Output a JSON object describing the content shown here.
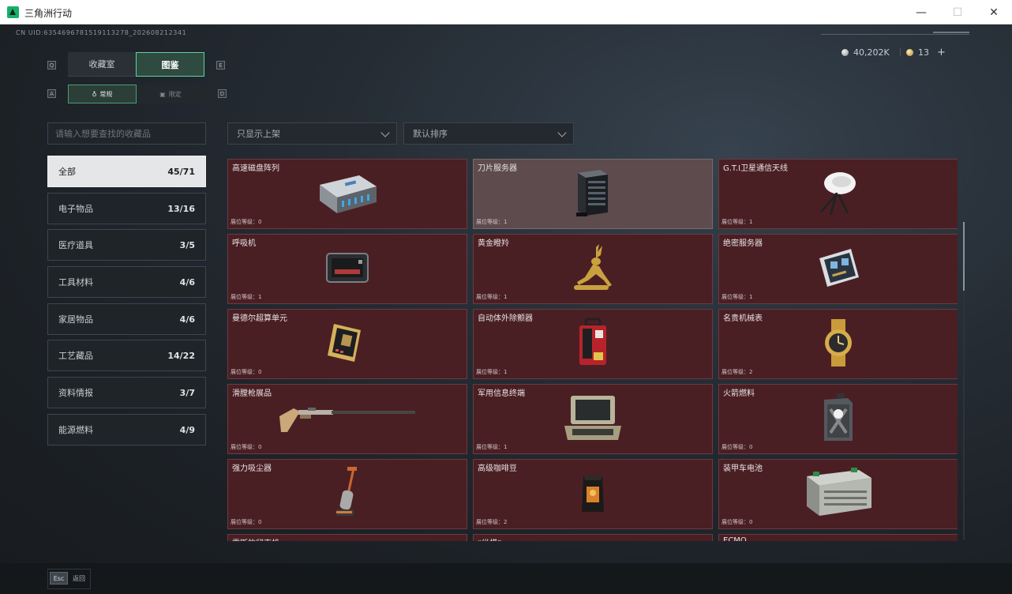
{
  "window": {
    "title": "三角洲行动"
  },
  "header": {
    "uid": "CN UID:6354696781519113278_202608212341",
    "currency": [
      {
        "icon": "silver-coin-icon",
        "value": "40,202K"
      },
      {
        "icon": "gold-coin-icon",
        "value": "13"
      }
    ],
    "add_symbol": "+"
  },
  "tabs": {
    "prev_key": "Q",
    "next_key": "E",
    "items": [
      {
        "label": "收藏室",
        "active": false
      },
      {
        "label": "图鉴",
        "active": true
      }
    ]
  },
  "sub_tabs": {
    "prev_key": "A",
    "next_key": "D",
    "items": [
      {
        "label": "常规",
        "active": true
      },
      {
        "label": "限定",
        "active": false
      }
    ]
  },
  "search": {
    "placeholder": "请输入想要查找的收藏品"
  },
  "filters": {
    "display": "只显示上架",
    "sort": "默认排序"
  },
  "categories": [
    {
      "label": "全部",
      "count": "45/71",
      "active": true
    },
    {
      "label": "电子物品",
      "count": "13/16"
    },
    {
      "label": "医疗道具",
      "count": "3/5"
    },
    {
      "label": "工具材料",
      "count": "4/6"
    },
    {
      "label": "家居物品",
      "count": "4/6"
    },
    {
      "label": "工艺藏品",
      "count": "14/22"
    },
    {
      "label": "资料情报",
      "count": "3/7"
    },
    {
      "label": "能源燃料",
      "count": "4/9"
    }
  ],
  "level_label": "展位等级：",
  "items": [
    {
      "name": "高速磁盘阵列",
      "level": "0",
      "icon": "disk-array-icon"
    },
    {
      "name": "刀片服务器",
      "level": "1",
      "icon": "blade-server-icon",
      "selected": true
    },
    {
      "name": "G.T.I卫星通信天线",
      "level": "1",
      "icon": "satellite-antenna-icon"
    },
    {
      "name": "呼吸机",
      "level": "1",
      "icon": "ventilator-icon"
    },
    {
      "name": "黄金瞪羚",
      "level": "1",
      "icon": "golden-gazelle-icon"
    },
    {
      "name": "绝密服务器",
      "level": "1",
      "icon": "secret-server-icon"
    },
    {
      "name": "曼德尔超算单元",
      "level": "0",
      "icon": "supercomputer-unit-icon"
    },
    {
      "name": "自动体外除颤器",
      "level": "1",
      "icon": "defibrillator-icon"
    },
    {
      "name": "名贵机械表",
      "level": "2",
      "icon": "mechanical-watch-icon"
    },
    {
      "name": "滑膛枪展品",
      "level": "0",
      "icon": "musket-icon"
    },
    {
      "name": "军用信息终端",
      "level": "1",
      "icon": "military-terminal-icon"
    },
    {
      "name": "火箭燃料",
      "level": "0",
      "icon": "rocket-fuel-icon"
    },
    {
      "name": "强力吸尘器",
      "level": "0",
      "icon": "vacuum-cleaner-icon"
    },
    {
      "name": "高级咖啡豆",
      "level": "2",
      "icon": "coffee-beans-icon"
    },
    {
      "name": "装甲车电池",
      "level": "0",
      "icon": "vehicle-battery-icon"
    },
    {
      "name": "雷斯的留声机",
      "level": "",
      "icon": "phonograph-icon"
    },
    {
      "name": "“纵横”",
      "level": "",
      "icon": "collectible-icon"
    },
    {
      "name": "ECMO",
      "level": "",
      "icon": "ecmo-icon"
    }
  ],
  "footer": {
    "esc_key": "Esc",
    "back_label": "返回"
  },
  "colors": {
    "accent": "#5fd39a",
    "card_bg": "#4a1f24",
    "card_selected": "#5d4b4e",
    "active_category": "#e4e6e8"
  }
}
